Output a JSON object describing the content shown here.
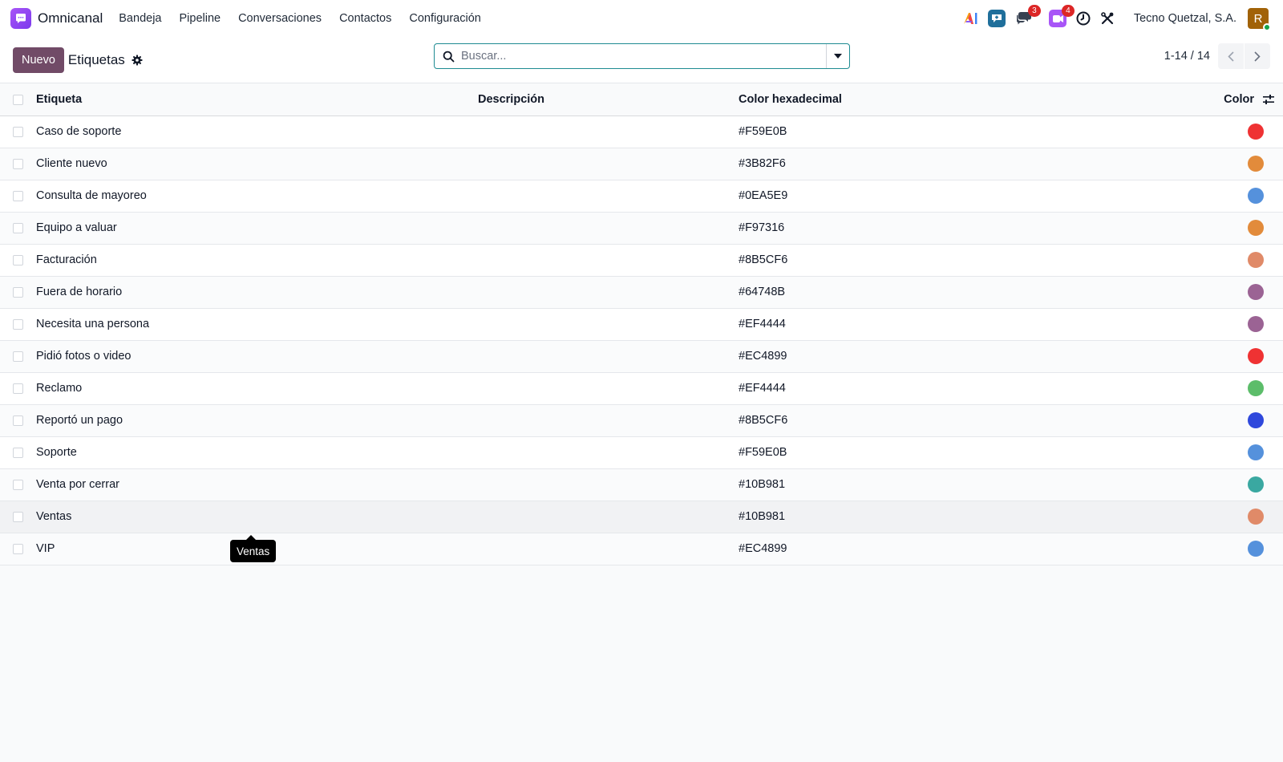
{
  "navbar": {
    "app_name": "Omnicanal",
    "menu": [
      "Bandeja",
      "Pipeline",
      "Conversaciones",
      "Contactos",
      "Configuración"
    ],
    "chat_badge": "3",
    "activity_badge": "4",
    "company": "Tecno Quetzal, S.A.",
    "avatar_letter": "R"
  },
  "control": {
    "new_label": "Nuevo",
    "title": "Etiquetas",
    "search_placeholder": "Buscar...",
    "pager": "1-14 / 14"
  },
  "table": {
    "headers": {
      "name": "Etiqueta",
      "description": "Descripción",
      "hex": "Color hexadecimal",
      "color": "Color"
    },
    "rows": [
      {
        "name": "Caso de soporte",
        "description": "",
        "hex": "#F59E0B",
        "swatch": "#ef3233"
      },
      {
        "name": "Cliente nuevo",
        "description": "",
        "hex": "#3B82F6",
        "swatch": "#e28b3b"
      },
      {
        "name": "Consulta de mayoreo",
        "description": "",
        "hex": "#0EA5E9",
        "swatch": "#5591dc"
      },
      {
        "name": "Equipo a valuar",
        "description": "",
        "hex": "#F97316",
        "swatch": "#e28b3b"
      },
      {
        "name": "Facturación",
        "description": "",
        "hex": "#8B5CF6",
        "swatch": "#e08a68"
      },
      {
        "name": "Fuera de horario",
        "description": "",
        "hex": "#64748B",
        "swatch": "#9b6394"
      },
      {
        "name": "Necesita una persona",
        "description": "",
        "hex": "#EF4444",
        "swatch": "#9b6394"
      },
      {
        "name": "Pidió fotos o video",
        "description": "",
        "hex": "#EC4899",
        "swatch": "#ef3233"
      },
      {
        "name": "Reclamo",
        "description": "",
        "hex": "#EF4444",
        "swatch": "#5cbd6a"
      },
      {
        "name": "Reportó un pago",
        "description": "",
        "hex": "#8B5CF6",
        "swatch": "#2f48dc"
      },
      {
        "name": "Soporte",
        "description": "",
        "hex": "#F59E0B",
        "swatch": "#5591dc"
      },
      {
        "name": "Venta por cerrar",
        "description": "",
        "hex": "#10B981",
        "swatch": "#3aa8a1"
      },
      {
        "name": "Ventas",
        "description": "",
        "hex": "#10B981",
        "swatch": "#e08a68"
      },
      {
        "name": "VIP",
        "description": "",
        "hex": "#EC4899",
        "swatch": "#5591dc"
      }
    ]
  },
  "tooltip": "Ventas",
  "colors": {
    "primary": "#714b67",
    "search_border": "#1e8b92",
    "badge": "#dc2626"
  }
}
